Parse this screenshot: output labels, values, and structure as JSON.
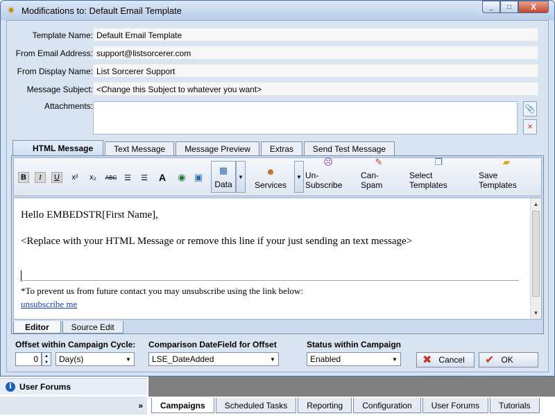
{
  "window": {
    "title": "Modifications to: Default Email Template",
    "controls": {
      "minimize": "_",
      "maximize": "□",
      "close": "X"
    }
  },
  "form": {
    "template_name": {
      "label": "Template Name:",
      "value": "Default Email Template"
    },
    "from_email": {
      "label": "From Email Address:",
      "value": "support@listsorcerer.com"
    },
    "from_display": {
      "label": "From Display Name:",
      "value": "List Sorcerer Support"
    },
    "subject": {
      "label": "Message Subject:",
      "value": "<Change this Subject to whatever you want>"
    },
    "attachments": {
      "label": "Attachments:"
    }
  },
  "message_tabs": [
    "HTML Message",
    "Text Message",
    "Message Preview",
    "Extras",
    "Send Test Message"
  ],
  "toolbar": {
    "format": {
      "bold": "B",
      "italic": "I",
      "underline": "U",
      "superscript": "x²",
      "subscript": "x₂",
      "strikethrough": "ABC",
      "font": "A"
    },
    "data_label": "Data",
    "services_label": "Services",
    "unsubscribe_label": "Un-Subscribe",
    "canspam_label": "Can-Spam",
    "select_templates_label": "Select Templates",
    "save_templates_label": "Save Templates"
  },
  "editor": {
    "greeting": "Hello EMBEDSTR[First Name],",
    "instruction": "<Replace with your HTML Message or remove this line if your just sending an text message>",
    "footer_note": "*To prevent us from future contact you may unsubscribe using the link below:",
    "unsubscribe_link": "unsubscribe me"
  },
  "editor_tabs": [
    "Editor",
    "Source Edit"
  ],
  "bottom": {
    "offset": {
      "label": "Offset within Campaign Cycle:",
      "value": "0",
      "unit": "Day(s)"
    },
    "datefield": {
      "label": "Comparison DateField for Offset",
      "value": "LSE_DateAdded"
    },
    "status": {
      "label": "Status within Campaign",
      "value": "Enabled"
    },
    "cancel_label": "Cancel",
    "ok_label": "OK"
  },
  "background": {
    "sidebar_item": "User Forums",
    "sidebar_chevrons": "»",
    "bottom_tabs": [
      "Campaigns",
      "Scheduled Tasks",
      "Reporting",
      "Configuration",
      "User Forums",
      "Tutorials"
    ]
  }
}
